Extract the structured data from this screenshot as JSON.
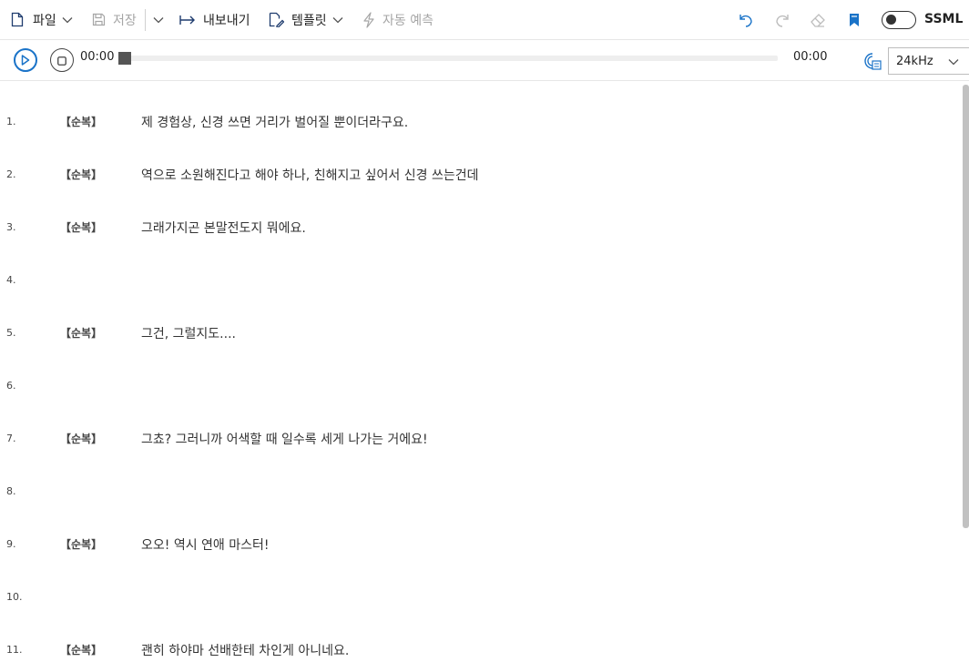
{
  "toolbar": {
    "file_label": "파일",
    "save_label": "저장",
    "export_label": "내보내기",
    "template_label": "템플릿",
    "autopredict_label": "자동 예측",
    "ssml_label": "SSML",
    "ssml_enabled": false
  },
  "player": {
    "current_time": "00:00",
    "total_time": "00:00",
    "progress": 0,
    "sample_rate": "24kHz"
  },
  "rows": [
    {
      "num": "1.",
      "speaker": "【순복】",
      "text": "제 경험상, 신경 쓰면 거리가 벌어질 뿐이더라구요."
    },
    {
      "num": "2.",
      "speaker": "【순복】",
      "text": "역으로 소원해진다고 해야 하나, 친해지고 싶어서 신경 쓰는건데"
    },
    {
      "num": "3.",
      "speaker": "【순복】",
      "text": "그래가지곤 본말전도지 뭐에요."
    },
    {
      "num": "4.",
      "speaker": "",
      "text": ""
    },
    {
      "num": "5.",
      "speaker": "【순복】",
      "text": "그건, 그럴지도...."
    },
    {
      "num": "6.",
      "speaker": "",
      "text": ""
    },
    {
      "num": "7.",
      "speaker": "【순복】",
      "text": "그쵸? 그러니까 어색할 때 일수록 세게 나가는 거에요!"
    },
    {
      "num": "8.",
      "speaker": "",
      "text": ""
    },
    {
      "num": "9.",
      "speaker": "【순복】",
      "text": "오오! 역시 연애 마스터!"
    },
    {
      "num": "10.",
      "speaker": "",
      "text": ""
    },
    {
      "num": "11.",
      "speaker": "【순복】",
      "text": "괜히 하야마 선배한테 차인게 아니네요."
    }
  ],
  "colors": {
    "accent": "#1a73c8",
    "disabled": "#a6a6a6"
  },
  "icons": {
    "file": "file-icon",
    "save": "save-icon",
    "export": "export-arrow-icon",
    "template": "template-edit-icon",
    "autopredict": "lightning-icon",
    "undo": "undo-icon",
    "redo": "redo-icon",
    "eraser": "eraser-icon",
    "bookmark": "bookmark-icon",
    "play": "play-icon",
    "stop": "stop-icon",
    "speed": "speed-icon"
  }
}
